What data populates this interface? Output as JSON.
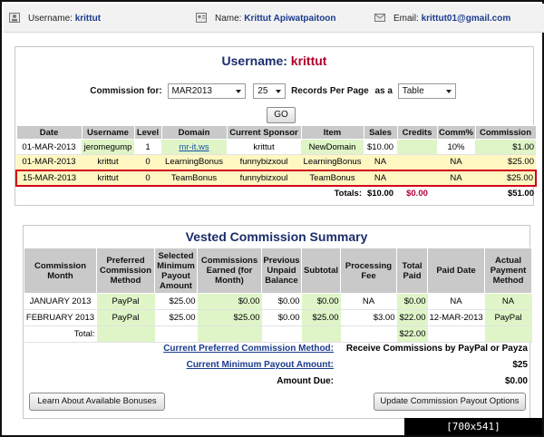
{
  "profile": {
    "username_label": "Username:",
    "username": "krittut",
    "name_label": "Name:",
    "name": "Krittut Apiwatpaitoon",
    "email_label": "Email:",
    "email": "krittut01@gmail.com"
  },
  "commission": {
    "title_prefix": "Username:",
    "title_user": "krittut",
    "filter_label": "Commission for:",
    "month_value": "MAR2013",
    "records_value": "25",
    "records_label": "Records Per Page",
    "as_label": "as a",
    "view_value": "Table",
    "go_label": "GO",
    "columns": [
      "Date",
      "Username",
      "Level",
      "Domain",
      "Current Sponsor",
      "Item",
      "Sales",
      "Credits",
      "Comm%",
      "Commission"
    ],
    "rows": [
      {
        "date": "01-MAR-2013",
        "username": "jeromegump",
        "level": "1",
        "domain": "mr-it.ws",
        "sponsor": "krittut",
        "item": "NewDomain",
        "sales": "$10.00",
        "credits": "",
        "comm_pct": "10%",
        "commission": "$1.00"
      },
      {
        "date": "01-MAR-2013",
        "username": "krittut",
        "level": "0",
        "domain": "LearningBonus",
        "sponsor": "funnybizxoul",
        "item": "LearningBonus",
        "sales": "NA",
        "credits": "",
        "comm_pct": "NA",
        "commission": "$25.00"
      },
      {
        "date": "15-MAR-2013",
        "username": "krittut",
        "level": "0",
        "domain": "TeamBonus",
        "sponsor": "funnybizxoul",
        "item": "TeamBonus",
        "sales": "NA",
        "credits": "",
        "comm_pct": "NA",
        "commission": "$25.00"
      }
    ],
    "totals": {
      "label": "Totals:",
      "sales": "$10.00",
      "credits": "$0.00",
      "commission": "$51.00"
    }
  },
  "vested": {
    "title": "Vested Commission Summary",
    "columns": [
      "Commission Month",
      "Preferred Commission Method",
      "Selected Minimum Payout Amount",
      "Commissions Earned (for Month)",
      "Previous Unpaid Balance",
      "Subtotal",
      "Processing Fee",
      "Total Paid",
      "Paid Date",
      "Actual Payment Method"
    ],
    "rows": [
      {
        "month": "JANUARY 2013",
        "method": "PayPal",
        "min_payout": "$25.00",
        "earned": "$0.00",
        "prev": "$0.00",
        "subtotal": "$0.00",
        "fee": "NA",
        "paid": "$0.00",
        "paid_date": "NA",
        "actual": "NA"
      },
      {
        "month": "FEBRUARY 2013",
        "method": "PayPal",
        "min_payout": "$25.00",
        "earned": "$25.00",
        "prev": "$0.00",
        "subtotal": "$25.00",
        "fee": "$3.00",
        "paid": "$22.00",
        "paid_date": "12-MAR-2013",
        "actual": "PayPal"
      }
    ],
    "total_label": "Total:",
    "total_paid": "$22.00",
    "pref_method_label": "Current Preferred Commission Method:",
    "pref_method_value": "Receive Commissions by PayPal or Payza",
    "min_payout_label": "Current Minimum Payout Amount:",
    "min_payout_value": "$25",
    "amount_due_label": "Amount Due:",
    "amount_due_value": "$0.00",
    "learn_button": "Learn About Available Bonuses",
    "update_button": "Update Commission Payout Options"
  },
  "badge": "[700x541] http://upic.me/",
  "colors": {
    "accent": "#1b2d6b",
    "highlight": "#d2001a",
    "positive_cell": "#dff5c8",
    "header_bg": "#c9c9c9"
  }
}
